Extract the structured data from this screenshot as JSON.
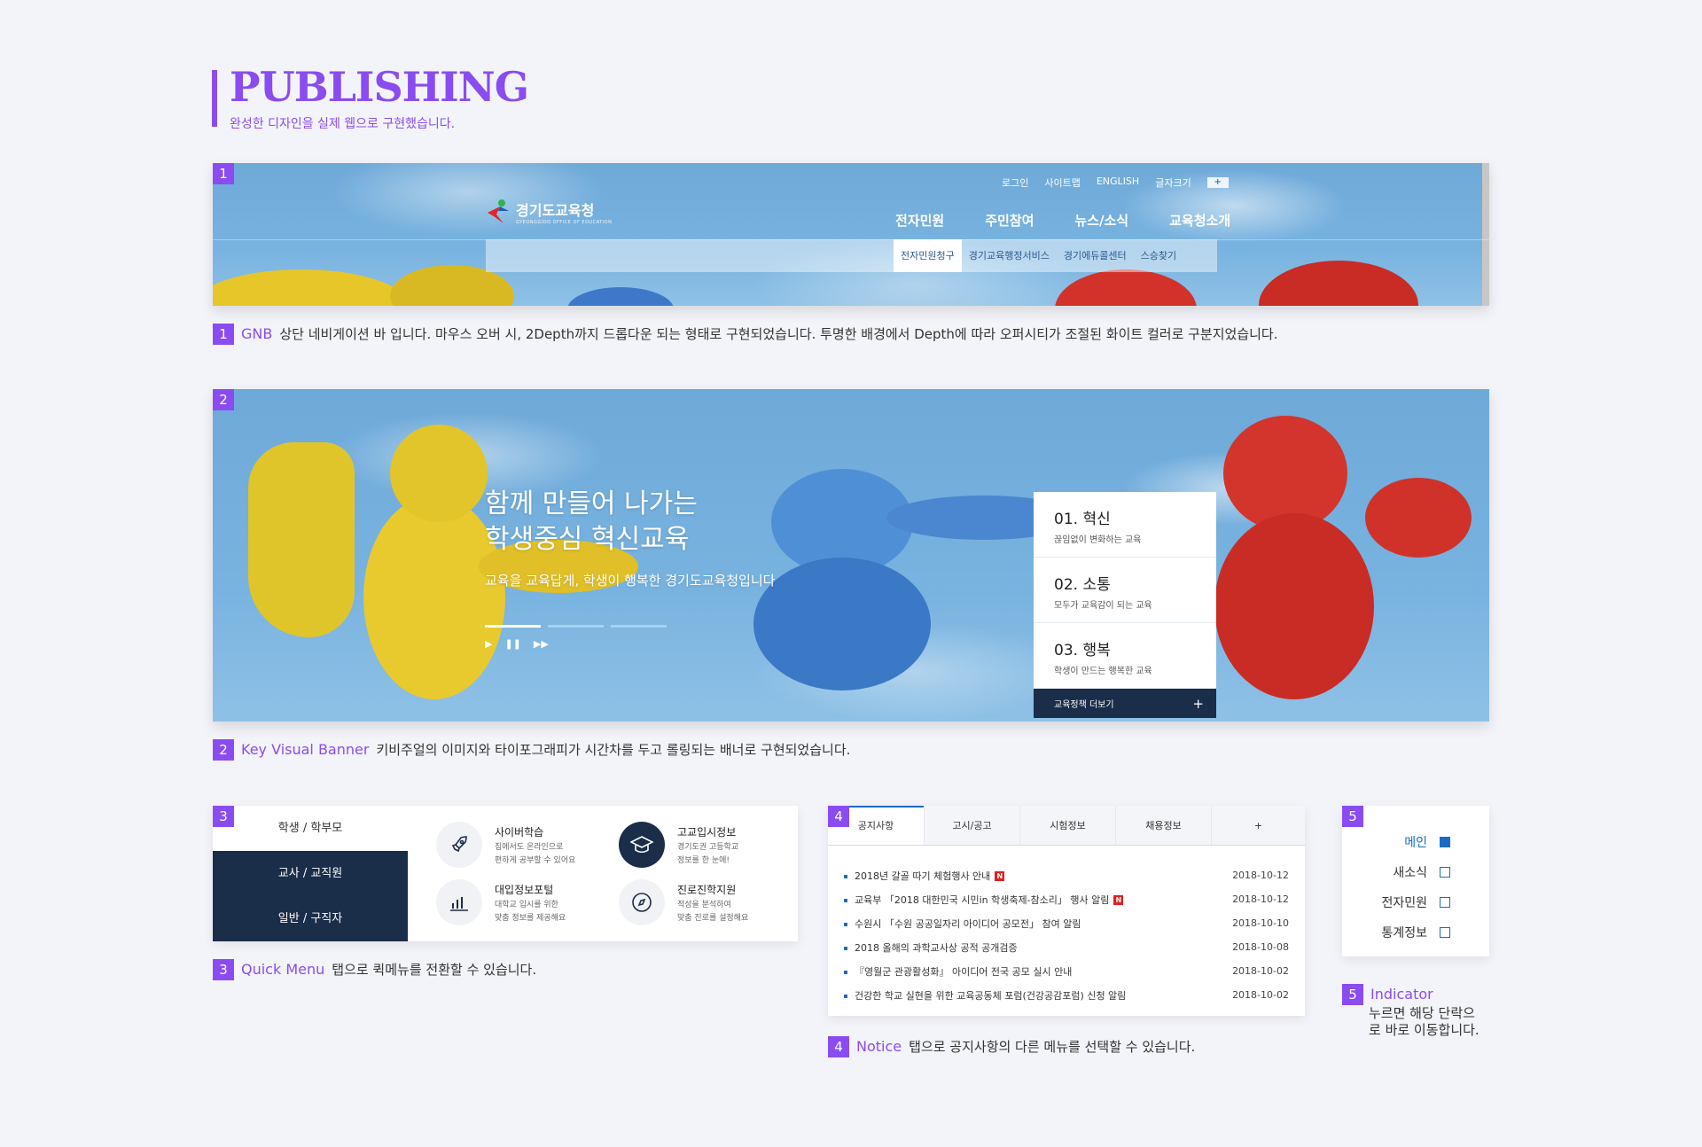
{
  "header": {
    "title": "PUBLISHING",
    "subtitle": "완성한 디자인을 실제 웹으로 구현했습니다."
  },
  "sections": {
    "gnb": {
      "num": "1",
      "title": "GNB",
      "desc": "상단 네비게이션 바 입니다. 마우스 오버 시, 2Depth까지 드롭다운 되는 형태로 구현되었습니다. 투명한 배경에서 Depth에 따라 오퍼시티가 조절된 화이트 컬러로 구분지었습니다."
    },
    "kv": {
      "num": "2",
      "title": "Key Visual Banner",
      "desc": "키비주얼의 이미지와 타이포그래피가 시간차를 두고 롤링되는 배너로 구현되었습니다."
    },
    "quick": {
      "num": "3",
      "title": "Quick Menu",
      "desc": "탭으로 퀵메뉴를 전환할 수 있습니다."
    },
    "notice": {
      "num": "4",
      "title": "Notice",
      "desc": "탭으로 공지사항의 다른 메뉴를 선택할 수 있습니다."
    },
    "indicator": {
      "num": "5",
      "title": "Indicator",
      "desc_line1": "누르면 해당 단락으",
      "desc_line2": "로 바로 이동합니다."
    }
  },
  "gnb_ui": {
    "util": [
      "로그인",
      "사이트맵",
      "ENGLISH",
      "글자크기"
    ],
    "zoom_label": "+",
    "logo_text": "경기도교육청",
    "logo_sub": "GYEONGGIDO OFFICE OF EDUCATION",
    "menu": [
      "전자민원",
      "주민참여",
      "뉴스/소식",
      "교육청소개"
    ],
    "sub": [
      "전자민원청구",
      "경기교육행정서비스",
      "경기에듀콜센터",
      "스승찾기"
    ]
  },
  "kv_ui": {
    "heading_line1": "함께 만들어 나가는",
    "heading_line2": "학생중심 혁신교육",
    "lead": "교육을 교육답게, 학생이 행복한 경기도교육청입니다",
    "controls": [
      "▶",
      "❚❚",
      "▶▶"
    ],
    "panel": [
      {
        "title": "01. 혁신",
        "desc": "끊임없이 변화하는 교육"
      },
      {
        "title": "02. 소통",
        "desc": "모두가 교육감이 되는 교육"
      },
      {
        "title": "03. 행복",
        "desc": "학생이 만드는 행복한 교육"
      }
    ],
    "more": "교육정책 더보기",
    "more_icon": "+"
  },
  "quick_ui": {
    "tabs": [
      "학생 / 학부모",
      "교사 / 교직원",
      "일반 / 구직자"
    ],
    "items": [
      {
        "title": "사이버학습",
        "desc1": "집에서도 온라인으로",
        "desc2": "편하게 공부할 수 있어요",
        "icon": "rocket-icon"
      },
      {
        "title": "고교입시정보",
        "desc1": "경기도권 고등학교",
        "desc2": "정보를 한 눈에!",
        "icon": "graduation-cap-icon"
      },
      {
        "title": "대입정보포털",
        "desc1": "대학교 입시를 위한",
        "desc2": "맞춤 정보를 제공해요",
        "icon": "bar-chart-icon"
      },
      {
        "title": "진로진학지원",
        "desc1": "적성을 분석하여",
        "desc2": "맞춤 진로를 설정해요",
        "icon": "compass-icon"
      }
    ]
  },
  "notice_ui": {
    "tabs": [
      "공지사항",
      "고시/공고",
      "시험정보",
      "채용정보",
      "+"
    ],
    "new_label": "N",
    "rows": [
      {
        "title": "2018년 갈골 따기 체험행사 안내",
        "date": "2018-10-12",
        "new": true
      },
      {
        "title": "교육부 「2018 대한민국 시민in 학생축제-참소리」 행사 알림",
        "date": "2018-10-12",
        "new": true
      },
      {
        "title": "수원시 「수원 공공일자리 아이디어 공모전」 참여 알림",
        "date": "2018-10-10",
        "new": false
      },
      {
        "title": "2018 올해의 과학교사상 공적 공개검증",
        "date": "2018-10-08",
        "new": false
      },
      {
        "title": "『영월군 관광활성화』 아이디어 전국 공모 실시 안내",
        "date": "2018-10-02",
        "new": false
      },
      {
        "title": "건강한 학교 실현을 위한 교육공동체 포럼(건강공감포럼) 신청 알림",
        "date": "2018-10-02",
        "new": false
      }
    ]
  },
  "indicator_ui": {
    "items": [
      "메인",
      "새소식",
      "전자민원",
      "통계정보"
    ],
    "active": 0
  },
  "colors": {
    "accent": "#8a4cf0",
    "navy": "#1a2d49",
    "blue": "#1a6bc4",
    "new_red": "#e02020"
  }
}
